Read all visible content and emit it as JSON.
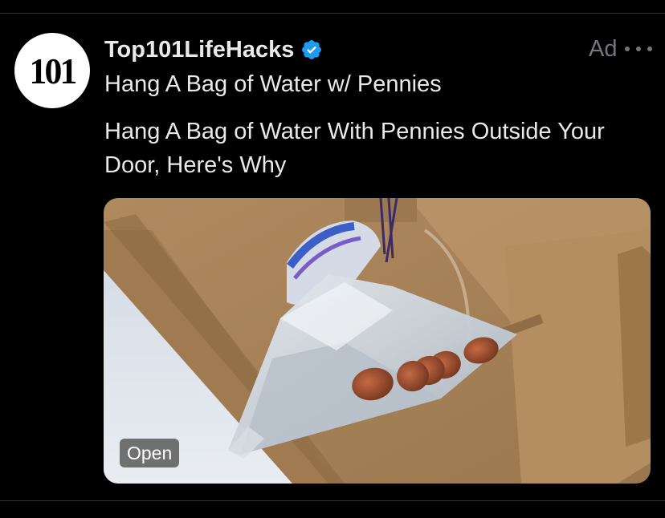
{
  "post": {
    "avatar_text": "101",
    "author_name": "Top101LifeHacks",
    "verified": true,
    "ad_label": "Ad",
    "subtitle": "Hang A Bag of Water w/ Pennies",
    "headline": "Hang A Bag of Water With Pennies Outside Your Door, Here's Why",
    "media": {
      "open_label": "Open"
    }
  },
  "icons": {
    "verified": "verified-badge-icon",
    "more": "more-options-icon"
  },
  "colors": {
    "background": "#000000",
    "text_primary": "#e7e9ea",
    "text_secondary": "#71767b",
    "verified_blue": "#1d9bf0",
    "divider": "#2f3336"
  }
}
